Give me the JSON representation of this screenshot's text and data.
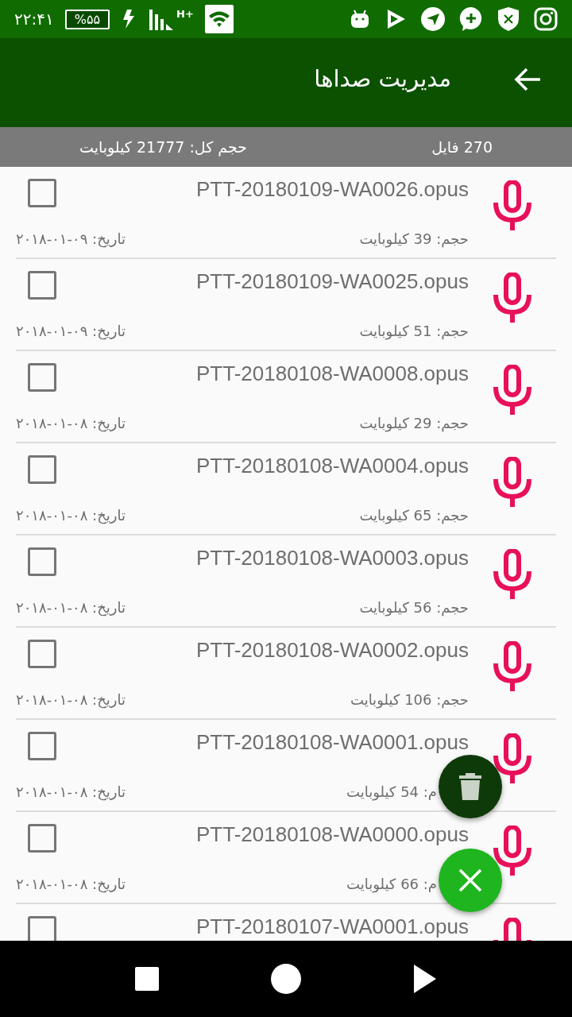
{
  "status_bar": {
    "time": "۲۲:۴۱",
    "battery": "%۵۵",
    "network": "H+"
  },
  "toolbar": {
    "title": "مدیریت صداها"
  },
  "summary": {
    "file_count": "270 فایل",
    "total_size": "حجم کل: 21777 کیلوبایت"
  },
  "files": [
    {
      "name": "PTT-20180109-WA0026.opus",
      "size": "حجم: 39 کیلوبایت",
      "date": "تاریخ: ۰۹-۰۱-۲۰۱۸",
      "checked": false
    },
    {
      "name": "PTT-20180109-WA0025.opus",
      "size": "حجم: 51 کیلوبایت",
      "date": "تاریخ: ۰۹-۰۱-۲۰۱۸",
      "checked": false
    },
    {
      "name": "PTT-20180108-WA0008.opus",
      "size": "حجم: 29 کیلوبایت",
      "date": "تاریخ: ۰۸-۰۱-۲۰۱۸",
      "checked": false
    },
    {
      "name": "PTT-20180108-WA0004.opus",
      "size": "حجم: 65 کیلوبایت",
      "date": "تاریخ: ۰۸-۰۱-۲۰۱۸",
      "checked": false
    },
    {
      "name": "PTT-20180108-WA0003.opus",
      "size": "حجم: 56 کیلوبایت",
      "date": "تاریخ: ۰۸-۰۱-۲۰۱۸",
      "checked": false
    },
    {
      "name": "PTT-20180108-WA0002.opus",
      "size": "حجم: 106 کیلوبایت",
      "date": "تاریخ: ۰۸-۰۱-۲۰۱۸",
      "checked": false
    },
    {
      "name": "PTT-20180108-WA0001.opus",
      "size": "م: 54 کیلوبایت",
      "size_partly_covered": true,
      "date": "تاریخ: ۰۸-۰۱-۲۰۱۸",
      "checked": false
    },
    {
      "name": "PTT-20180108-WA0000.opus",
      "size": "م: 66 کیلوبایت",
      "size_partly_covered": true,
      "date": "تاریخ: ۰۸-۰۱-۲۰۱۸",
      "checked": false
    },
    {
      "name": "PTT-20180107-WA0001.opus",
      "checked": false
    }
  ]
}
